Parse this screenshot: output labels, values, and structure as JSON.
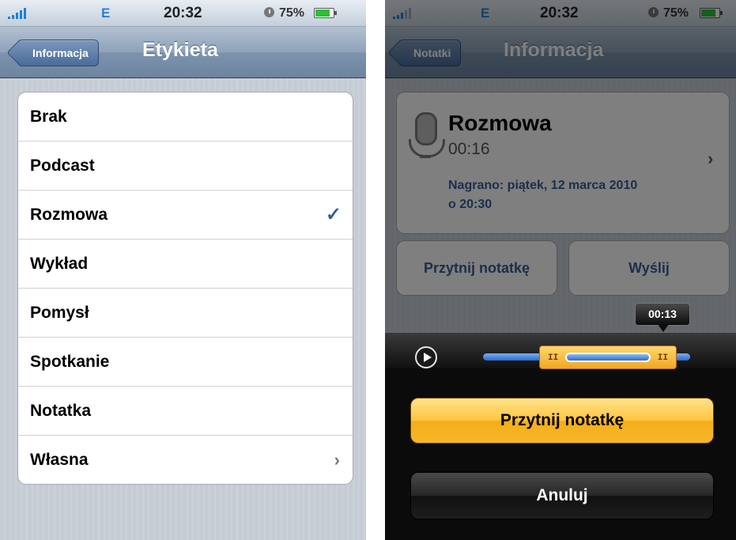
{
  "left_screen": {
    "status": {
      "carrier": "E",
      "time": "20:32",
      "battery": "75%"
    },
    "nav": {
      "back_label": "Informacja",
      "title": "Etykieta"
    },
    "labels": [
      {
        "text": "Brak",
        "accessory": ""
      },
      {
        "text": "Podcast",
        "accessory": ""
      },
      {
        "text": "Rozmowa",
        "accessory": "✓"
      },
      {
        "text": "Wykład",
        "accessory": ""
      },
      {
        "text": "Pomysł",
        "accessory": ""
      },
      {
        "text": "Spotkanie",
        "accessory": ""
      },
      {
        "text": "Notatka",
        "accessory": ""
      },
      {
        "text": "Własna",
        "accessory": "›"
      }
    ],
    "selected_label": "Rozmowa"
  },
  "right_screen": {
    "status": {
      "carrier": "E",
      "time": "20:32",
      "battery": "75%"
    },
    "nav": {
      "back_label": "Notatki",
      "title": "Informacja"
    },
    "recording": {
      "title": "Rozmowa",
      "duration": "00:16",
      "recorded_line1": "Nagrano: piątek, 12 marca 2010",
      "recorded_line2": "o 20:30",
      "chevron": "›"
    },
    "actions": {
      "trim_label": "Przytnij notatkę",
      "share_label": "Wyślij"
    },
    "trimmer": {
      "time_bubble": "00:13",
      "trim_button": "Przytnij notatkę",
      "cancel_button": "Anuluj"
    }
  },
  "colors": {
    "nav_blue": "#6d849f",
    "link_blue": "#3a5d97",
    "trim_yellow": "#ffc53b",
    "battery_green": "#2dbf36"
  },
  "icons": [
    "signal-icon",
    "alarm-icon",
    "battery-icon",
    "microphone-icon",
    "checkmark-icon",
    "chevron-right-icon",
    "play-icon"
  ]
}
